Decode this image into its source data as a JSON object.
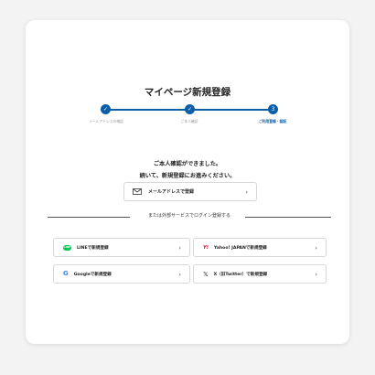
{
  "page": {
    "title": "マイページ新規登録",
    "accent_color": "#0b5ea8",
    "steps": [
      {
        "label": "メールアドレスの確認",
        "marker": "✓",
        "state": "done"
      },
      {
        "label": "ご本人確認",
        "marker": "✓",
        "state": "done"
      },
      {
        "label": "ご利用登録・認証",
        "marker": "3",
        "state": "current"
      }
    ],
    "message_line1": "ご本人確認ができました。",
    "message_line2": "続いて、新規登録にお進みください。",
    "email_button": {
      "label": "メールアドレスで登録",
      "icon": "mail-icon"
    },
    "divider_text": "または外部サービスでログイン登録する",
    "social_buttons": [
      {
        "label": "LINEで新規登録",
        "icon": "line-icon",
        "icon_text": "LINE"
      },
      {
        "label": "Yahoo! JAPANで新規登録",
        "icon": "yahoo-icon",
        "icon_text": "Y!"
      },
      {
        "label": "Googleで新規登録",
        "icon": "google-icon",
        "icon_text": "G"
      },
      {
        "label": "X（旧Twitter）で新規登録",
        "icon": "x-icon",
        "icon_text": "𝕏"
      }
    ],
    "chevron": "›"
  }
}
